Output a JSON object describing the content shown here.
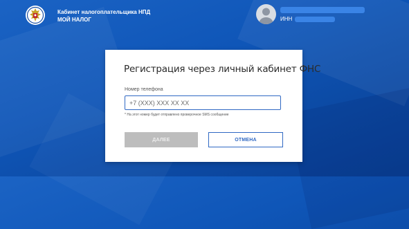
{
  "header": {
    "brand_line1": "Кабинет налогоплательщика НПД",
    "brand_line2": "МОЙ НАЛОГ",
    "logo_icon": "fns-emblem-icon",
    "avatar_icon": "user-avatar-icon",
    "inn_label": "ИНН"
  },
  "registration": {
    "title": "Регистрация через личный кабинет ФНС",
    "phone_label": "Номер телефона",
    "phone_placeholder": "+7 (XXX) XXX XX XX",
    "hint": "* На этот номер будет отправлено проверочное SMS сообщение",
    "next_button": "ДАЛЕЕ",
    "cancel_button": "ОТМЕНА"
  },
  "colors": {
    "background": "#1158bb",
    "accent": "#2f68c3",
    "disabled_button": "#bdbdbd"
  }
}
